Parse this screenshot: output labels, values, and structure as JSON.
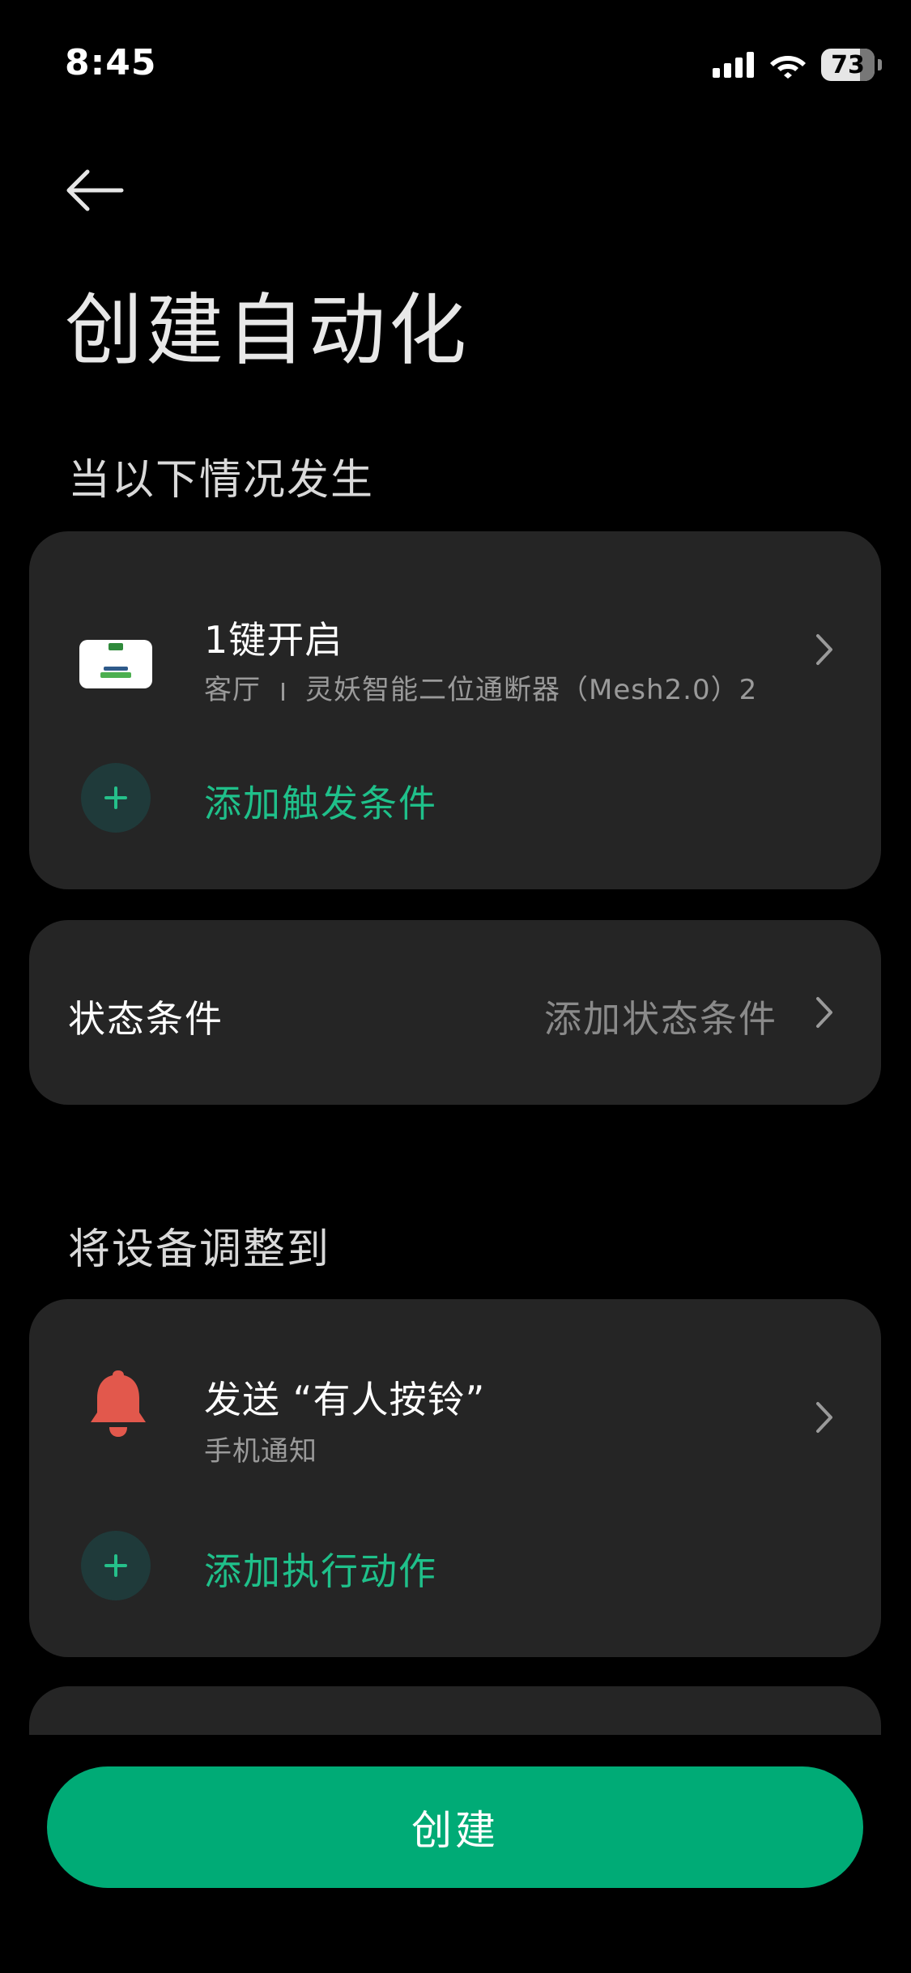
{
  "status_bar": {
    "time": "8:45",
    "battery": "73",
    "icons": [
      "cellular-signal-icon",
      "wifi-icon",
      "battery-icon"
    ]
  },
  "header": {
    "back_icon": "arrow-left-icon",
    "title": "创建自动化"
  },
  "trigger_section": {
    "title": "当以下情况发生",
    "trigger": {
      "title": "1键开启",
      "room": "客厅",
      "device": "灵妖智能二位通断器（Mesh2.0）2"
    },
    "add_label": "添加触发条件"
  },
  "state_condition": {
    "label": "状态条件",
    "value": "添加状态条件"
  },
  "action_section": {
    "title": "将设备调整到",
    "action": {
      "title": "发送 “有人按铃”",
      "subtitle": "手机通知"
    },
    "add_label": "添加执行动作"
  },
  "create_button": "创建",
  "colors": {
    "background": "#000000",
    "card": "#252525",
    "accent": "#1fc08a",
    "button": "#00ab76",
    "bell": "#e2584c"
  }
}
